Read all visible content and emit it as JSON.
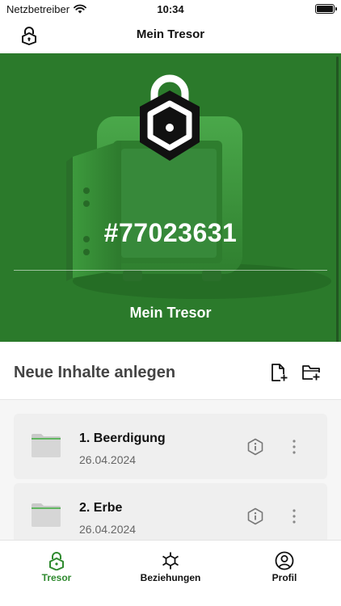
{
  "status_bar": {
    "carrier": "Netzbetreiber",
    "time": "10:34"
  },
  "nav": {
    "title": "Mein Tresor"
  },
  "hero": {
    "number": "#77023631",
    "title": "Mein Tresor"
  },
  "create": {
    "title": "Neue Inhalte anlegen"
  },
  "items": [
    {
      "title": "1. Beerdigung",
      "date": "26.04.2024"
    },
    {
      "title": "2. Erbe",
      "date": "26.04.2024"
    }
  ],
  "tabs": [
    {
      "label": "Tresor",
      "icon": "lock-icon",
      "active": true
    },
    {
      "label": "Beziehungen",
      "icon": "network-icon",
      "active": false
    },
    {
      "label": "Profil",
      "icon": "profile-icon",
      "active": false
    }
  ],
  "colors": {
    "brand_green": "#2b7a2b",
    "active_tab": "#2f8a2f",
    "folder_accent": "#3cae3c"
  }
}
